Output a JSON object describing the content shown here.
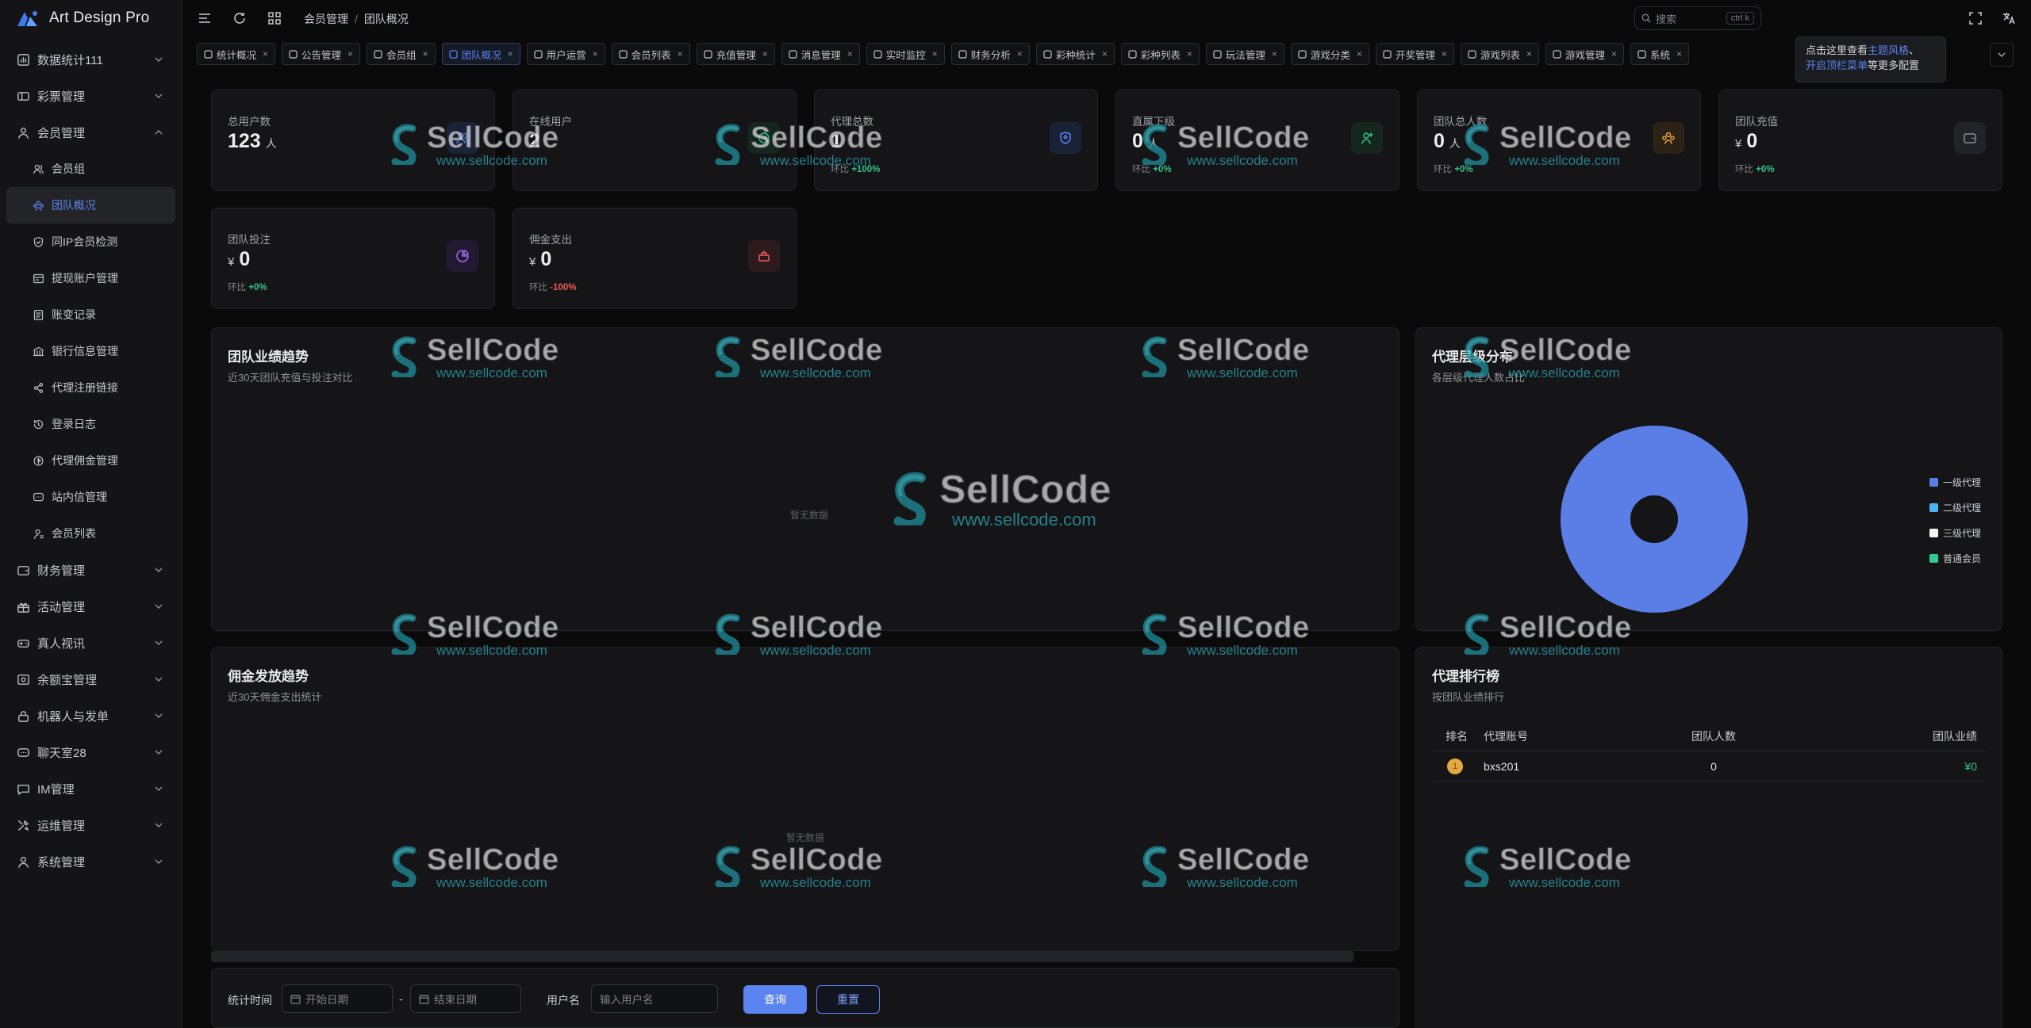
{
  "app": {
    "title": "Art Design Pro"
  },
  "breadcrumb": {
    "parent": "会员管理",
    "sep": "/",
    "current": "团队概况"
  },
  "search": {
    "placeholder": "搜索",
    "shortcut": "ctrl k"
  },
  "sidebar": {
    "items": [
      {
        "label": "数据统计111",
        "icon": "chart-icon",
        "expandable": true
      },
      {
        "label": "彩票管理",
        "icon": "ticket-icon",
        "expandable": true
      },
      {
        "label": "会员管理",
        "icon": "user-icon",
        "expandable": true,
        "expanded": true
      }
    ],
    "sub_items": [
      {
        "label": "会员组",
        "icon": "users-icon"
      },
      {
        "label": "团队概况",
        "icon": "team-icon",
        "active": true
      },
      {
        "label": "同IP会员检测",
        "icon": "shield-icon"
      },
      {
        "label": "提现账户管理",
        "icon": "card-icon"
      },
      {
        "label": "账变记录",
        "icon": "doc-icon"
      },
      {
        "label": "银行信息管理",
        "icon": "bank-icon"
      },
      {
        "label": "代理注册链接",
        "icon": "share-icon"
      },
      {
        "label": "登录日志",
        "icon": "history-icon"
      },
      {
        "label": "代理佣金管理",
        "icon": "coin-icon"
      },
      {
        "label": "站内信管理",
        "icon": "message-icon"
      },
      {
        "label": "会员列表",
        "icon": "user-list-icon"
      }
    ],
    "bottom_items": [
      {
        "label": "财务管理",
        "icon": "wallet-icon"
      },
      {
        "label": "活动管理",
        "icon": "gift-icon"
      },
      {
        "label": "真人视讯",
        "icon": "game-icon"
      },
      {
        "label": "余额宝管理",
        "icon": "vault-icon"
      },
      {
        "label": "机器人与发单",
        "icon": "lock-icon"
      },
      {
        "label": "聊天室28",
        "icon": "chat-room-icon"
      },
      {
        "label": "IM管理",
        "icon": "im-icon"
      },
      {
        "label": "运维管理",
        "icon": "tools-icon"
      },
      {
        "label": "系统管理",
        "icon": "system-user-icon"
      }
    ]
  },
  "tabs": [
    {
      "label": "统计概况"
    },
    {
      "label": "公告管理"
    },
    {
      "label": "会员组"
    },
    {
      "label": "团队概况",
      "active": true
    },
    {
      "label": "用户运营"
    },
    {
      "label": "会员列表"
    },
    {
      "label": "充值管理"
    },
    {
      "label": "消息管理"
    },
    {
      "label": "实时监控"
    },
    {
      "label": "财务分析"
    },
    {
      "label": "彩种统计"
    },
    {
      "label": "彩种列表"
    },
    {
      "label": "玩法管理"
    },
    {
      "label": "游戏分类"
    },
    {
      "label": "开奖管理"
    },
    {
      "label": "游戏列表"
    },
    {
      "label": "游戏管理"
    },
    {
      "label": "系统"
    }
  ],
  "tooltip": {
    "line1_prefix": "点击这里查看",
    "link1": "主题风格",
    "sep": "、",
    "link2": "开启顶栏菜单",
    "suffix": "等更多配置"
  },
  "stats": [
    {
      "label": "总用户数",
      "value": "123",
      "unit": "人",
      "icon": "users-icon",
      "icon_color": "#5c84f0",
      "icon_bg": "#1a2238"
    },
    {
      "label": "在线用户",
      "value": "2",
      "unit": "",
      "icon": "online-icon",
      "icon_color": "#30c38f",
      "icon_bg": "#15261f"
    },
    {
      "label": "代理总数",
      "value": "1",
      "unit": "",
      "change_label": "环比",
      "change": "+100%",
      "trend": "up",
      "icon": "agent-icon",
      "icon_color": "#5c84f0",
      "icon_bg": "#1a2238"
    },
    {
      "label": "直属下级",
      "value": "0",
      "unit": "人",
      "change_label": "环比",
      "change": "+0%",
      "trend": "up",
      "icon": "user-add-icon",
      "icon_color": "#30c38f",
      "icon_bg": "#15261f"
    },
    {
      "label": "团队总人数",
      "value": "0",
      "unit": "人",
      "change_label": "环比",
      "change": "+0%",
      "trend": "up",
      "icon": "team-icon",
      "icon_color": "#e8a43a",
      "icon_bg": "#2b2115"
    },
    {
      "label": "团队充值",
      "value": "0",
      "currency": "¥",
      "change_label": "环比",
      "change": "+0%",
      "trend": "up",
      "icon": "wallet-icon",
      "icon_color": "#8b8f96",
      "icon_bg": "#222326"
    },
    {
      "label": "团队投注",
      "value": "0",
      "currency": "¥",
      "change_label": "环比",
      "change": "+0%",
      "trend": "up",
      "icon": "pie-icon",
      "icon_color": "#a06cf0",
      "icon_bg": "#221a33"
    },
    {
      "label": "佣金支出",
      "value": "0",
      "currency": "¥",
      "change_label": "环比",
      "change": "-100%",
      "trend": "down",
      "icon": "coins-icon",
      "icon_color": "#ef5a5a",
      "icon_bg": "#2d1a1c"
    }
  ],
  "panels": {
    "team_trend": {
      "title": "团队业绩趋势",
      "subtitle": "近30天团队充值与投注对比",
      "empty": "暂无数据"
    },
    "agent_dist": {
      "title": "代理层级分布",
      "subtitle": "各层级代理人数占比"
    },
    "commission": {
      "title": "佣金发放趋势",
      "subtitle": "近30天佣金支出统计",
      "empty": "暂无数据"
    },
    "ranking": {
      "title": "代理排行榜",
      "subtitle": "按团队业绩排行",
      "headers": [
        "排名",
        "代理账号",
        "团队人数",
        "团队业绩"
      ],
      "rows": [
        {
          "rank": "1",
          "account": "bxs201",
          "members": "0",
          "performance": "¥0"
        }
      ]
    }
  },
  "chart_data": {
    "type": "pie",
    "categories": [
      "一级代理",
      "二级代理",
      "三级代理",
      "普通会员"
    ],
    "values": [
      1,
      0,
      0,
      0
    ],
    "colors": [
      "#5a7ee6",
      "#4db3f0",
      "#f2f3f5",
      "#2ec99a"
    ],
    "legend": "right"
  },
  "filter": {
    "time_label": "统计时间",
    "start_placeholder": "开始日期",
    "dash": "-",
    "end_placeholder": "结束日期",
    "user_label": "用户名",
    "user_placeholder": "输入用户名",
    "query": "查询",
    "reset": "重置"
  },
  "watermark": {
    "name": "SellCode",
    "url": "www.sellcode.com"
  }
}
